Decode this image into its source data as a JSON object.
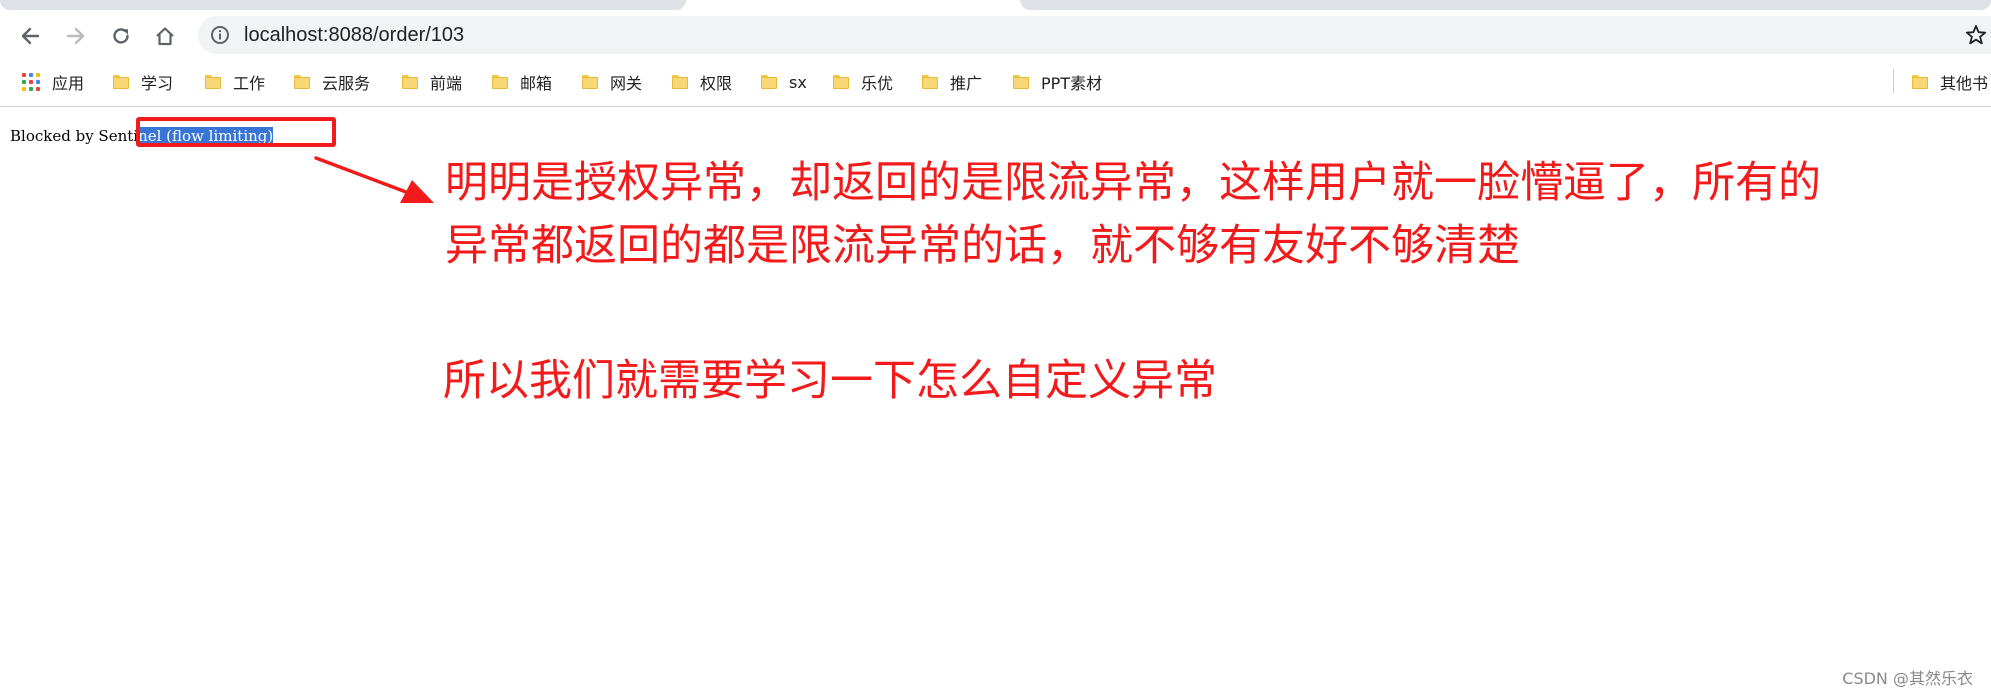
{
  "browser": {
    "url": "localhost:8088/order/103"
  },
  "bookmarks": {
    "apps_label": "应用",
    "items": [
      "学习",
      "工作",
      "云服务",
      "前端",
      "邮箱",
      "网关",
      "权限",
      "sx",
      "乐优",
      "推广",
      "PPT素材"
    ],
    "other_label": "其他书"
  },
  "page": {
    "text_prefix": "Blocked by Senti",
    "text_selected": "nel (flow limiting)"
  },
  "annotation": {
    "line1": "明明是授权异常，却返回的是限流异常，这样用户就一脸懵逼了，所有的",
    "line2": "异常都返回的都是限流异常的话，就不够有友好不够清楚",
    "line3": "所以我们就需要学习一下怎么自定义异常"
  },
  "watermark": "CSDN @其然乐衣",
  "colors": {
    "annotation_red": "#f21a1a",
    "selection_blue": "#3875d7",
    "folder_yellow": "#f8d775"
  }
}
